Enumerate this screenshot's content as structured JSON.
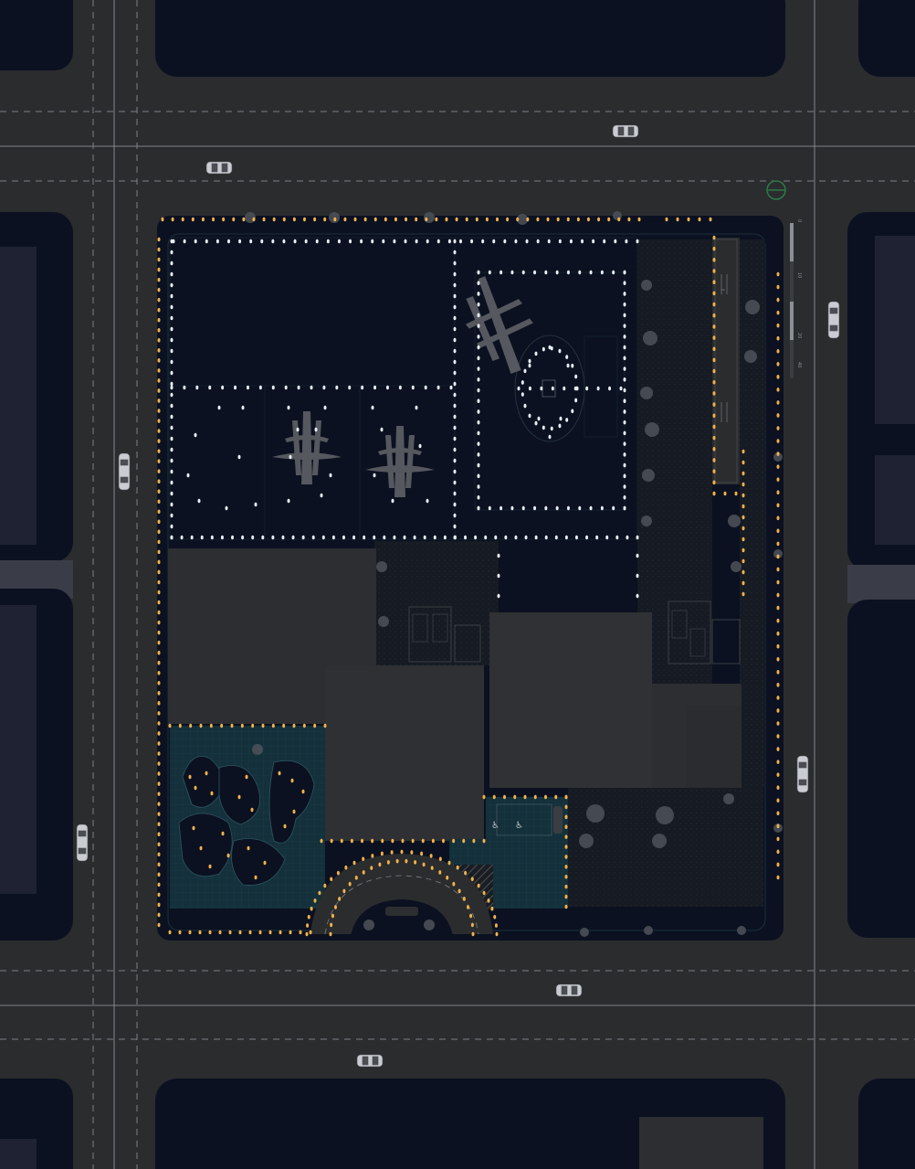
{
  "plan": {
    "scale_labels": [
      "0",
      "10",
      "20",
      "40"
    ]
  },
  "colors": {
    "road": "#2a2c2e",
    "block": "#0b1120",
    "block_outline": "#1c2235",
    "building": "#2c2e31",
    "building_light": "#313336",
    "warm_light": "#f2b24a",
    "cool_light": "#e9eef5",
    "lane_dash": "#7c8087",
    "tree": "#5a5e68",
    "plaza_tile": "#18323c",
    "grass": "#151a22"
  },
  "icons": {
    "accessible_parking": "wheelchair-icon",
    "north_arrow": "north-arrow-icon"
  }
}
